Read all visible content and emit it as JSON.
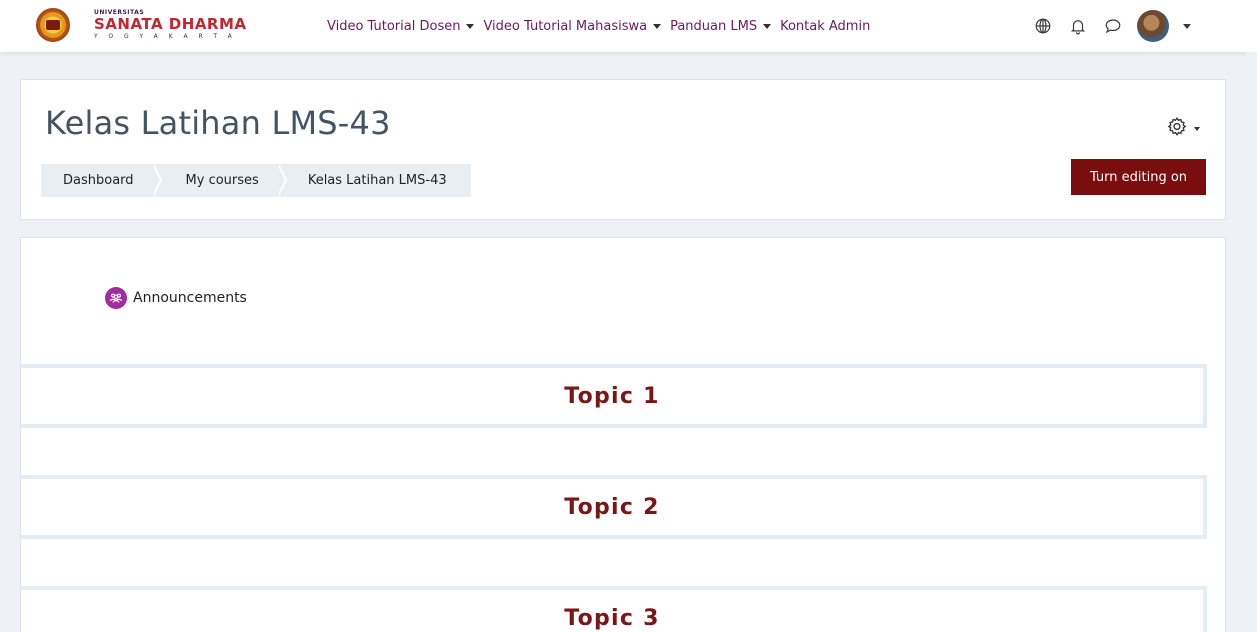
{
  "colors": {
    "brand_maroon": "#7a0d0d",
    "nav_text": "#6a1b5e",
    "title_text": "#455463",
    "topic_text": "#7a1616",
    "announce_icon_bg": "#a12ea0",
    "breadcrumb_bg": "#e9eef3"
  },
  "navbar": {
    "logo": {
      "university_label": "UNIVERSITAS",
      "name": "SANATA DHARMA",
      "city": "YOGYAKARTA",
      "seal_icon": "university-seal-icon"
    },
    "menu": [
      {
        "label": "Video Tutorial Dosen",
        "has_dropdown": true
      },
      {
        "label": "Video Tutorial Mahasiswa",
        "has_dropdown": true
      },
      {
        "label": "Panduan LMS",
        "has_dropdown": true
      },
      {
        "label": "Kontak Admin",
        "has_dropdown": false
      }
    ],
    "icons": {
      "language": "globe-icon",
      "notifications": "bell-icon",
      "messages": "chat-bubble-icon",
      "user_menu": "avatar"
    }
  },
  "header": {
    "title": "Kelas Latihan LMS-43",
    "breadcrumb": [
      "Dashboard",
      "My courses",
      "Kelas Latihan LMS-43"
    ],
    "settings_icon": "gear-icon",
    "edit_button_label": "Turn editing on"
  },
  "main": {
    "announcements": {
      "label": "Announcements",
      "icon": "forum-icon"
    },
    "topics": [
      {
        "title": "Topic 1"
      },
      {
        "title": "Topic 2"
      },
      {
        "title": "Topic 3"
      }
    ]
  }
}
